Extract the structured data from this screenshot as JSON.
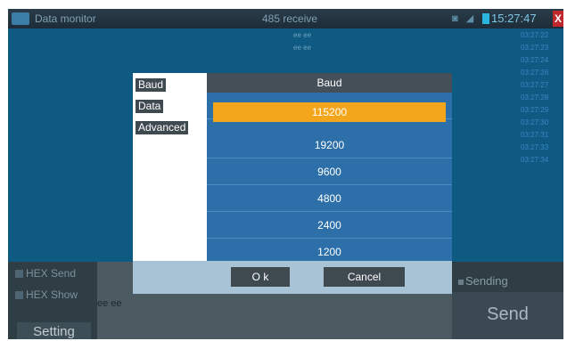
{
  "titlebar": {
    "app_title": "Data monitor",
    "mode_title": "485 receive",
    "clock": "15:27:47",
    "close_glyph": "X",
    "status_icons": "◙ ◢"
  },
  "monitor": {
    "data_lines": [
      "ee ee",
      "ee ee"
    ],
    "timestamps": [
      "03:27:22",
      "03:27:23",
      "03:27:24",
      "03:27:26",
      "03:27:27",
      "03:27:28",
      "03:27:29",
      "03:27:30",
      "03:27:31",
      "03:27:33",
      "03:27:34"
    ]
  },
  "bottom": {
    "hex_send_label": "HEX Send",
    "hex_show_label": "HEX Show",
    "hex_text": "ee ee",
    "setting_label": "Setting",
    "sending_label": "Sending",
    "send_label": "Send"
  },
  "dialog": {
    "sidebar": [
      "Baud",
      "Data",
      "Advanced"
    ],
    "header": "Baud",
    "options": [
      "115200",
      "19200",
      "9600",
      "4800",
      "2400",
      "1200"
    ],
    "selected": "115200",
    "ok_label": "O k",
    "cancel_label": "Cancel"
  },
  "colors": {
    "selected_option": "#f3a61b",
    "option_bg": "#2d6fa8",
    "close_red": "#c0282d"
  },
  "icons": [
    "app-icon",
    "signal-icon",
    "battery-icon",
    "close-icon"
  ]
}
